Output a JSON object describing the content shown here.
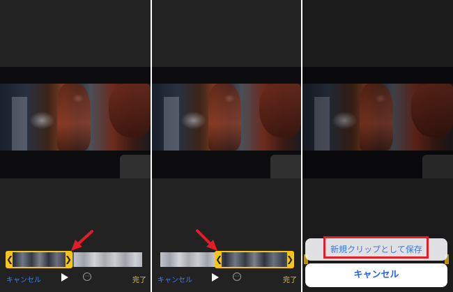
{
  "panels": [
    {
      "cancel_label": "キャンセル",
      "done_label": "完了",
      "more_symbol": "···",
      "selection": {
        "left_chevron": "❮",
        "right_chevron": "❯"
      }
    },
    {
      "cancel_label": "キャンセル",
      "done_label": "完了",
      "more_symbol": "···",
      "selection": {
        "left_chevron": "❮",
        "right_chevron": "❯"
      }
    },
    {
      "save_new_clip_label": "新規クリップとして保存",
      "cancel_label": "キャンセル"
    }
  ],
  "colors": {
    "accent_yellow": "#f5c518",
    "link_blue": "#3b82f6",
    "annotation_red": "#e11d2a"
  },
  "icons": {
    "play": "play-icon",
    "more": "more-icon",
    "annotation": "red-arrow-icon"
  }
}
